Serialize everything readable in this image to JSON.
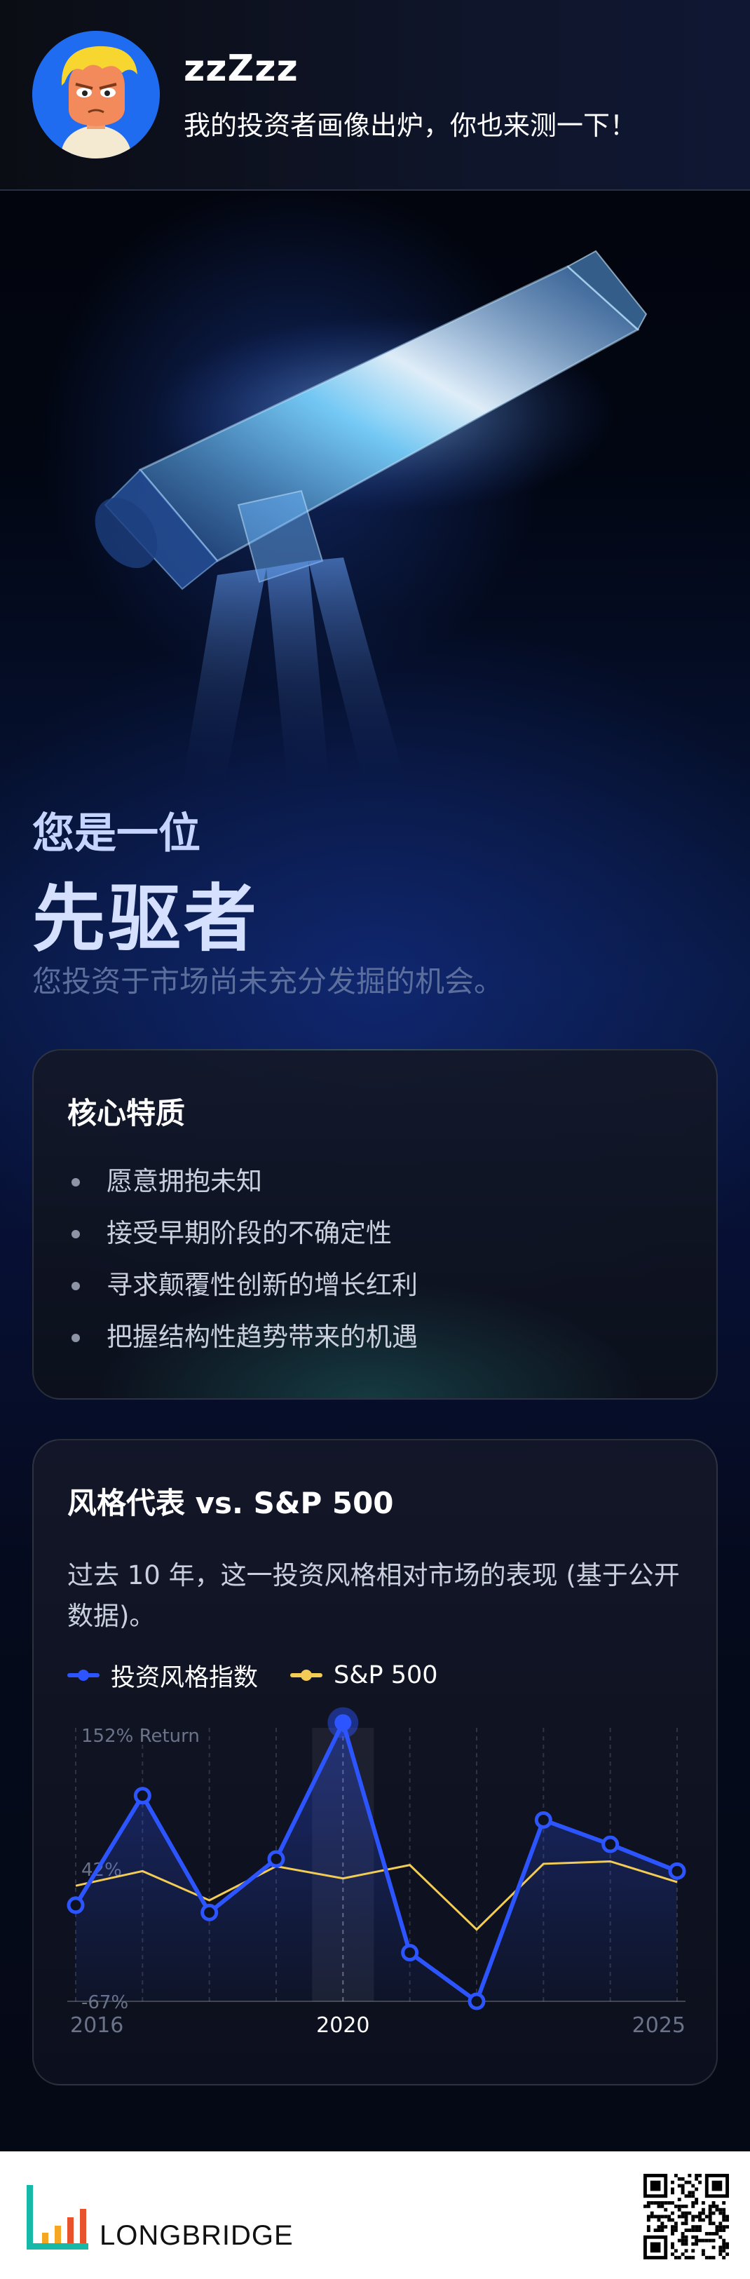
{
  "header": {
    "username": "zzZzz",
    "tagline": "我的投资者画像出炉，你也来测一下！"
  },
  "hero": {
    "intro": "您是一位",
    "title": "先驱者",
    "subtitle": "您投资于市场尚未充分发掘的机会。"
  },
  "traits_card": {
    "title": "核心特质",
    "items": [
      "愿意拥抱未知",
      "接受早期阶段的不确定性",
      "寻求颠覆性创新的增长红利",
      "把握结构性趋势带来的机遇"
    ]
  },
  "chart_card": {
    "title": "风格代表 vs. S&P 500",
    "description": "过去 10 年，这一投资风格相对市场的表现 (基于公开数据)。"
  },
  "colors": {
    "style_index": "#2d55ff",
    "sp500": "#f2cc55",
    "accent_text": "#d5e0ff"
  },
  "chart_data": {
    "type": "line",
    "x": [
      2016,
      2017,
      2018,
      2019,
      2020,
      2021,
      2022,
      2023,
      2024,
      2025
    ],
    "x_tick_labels": [
      "2016",
      "2020",
      "2025"
    ],
    "highlighted_x": 2020,
    "y_tick_labels": [
      "152% Return",
      "42%",
      "-67%"
    ],
    "y_ticks": [
      152,
      42,
      -67
    ],
    "ylim": [
      -67,
      152
    ],
    "grid": true,
    "legend_position": "top-left",
    "series": [
      {
        "name": "投资风格指数",
        "values": [
          12,
          102,
          6,
          50,
          162,
          -27,
          -67,
          82,
          62,
          40
        ]
      },
      {
        "name": "S&P 500",
        "values": [
          28,
          40,
          16,
          44,
          34,
          45,
          -8,
          46,
          48,
          31
        ]
      }
    ]
  },
  "footer": {
    "brand": "LONGBRIDGE",
    "qr_icon": "qr-code-icon"
  }
}
